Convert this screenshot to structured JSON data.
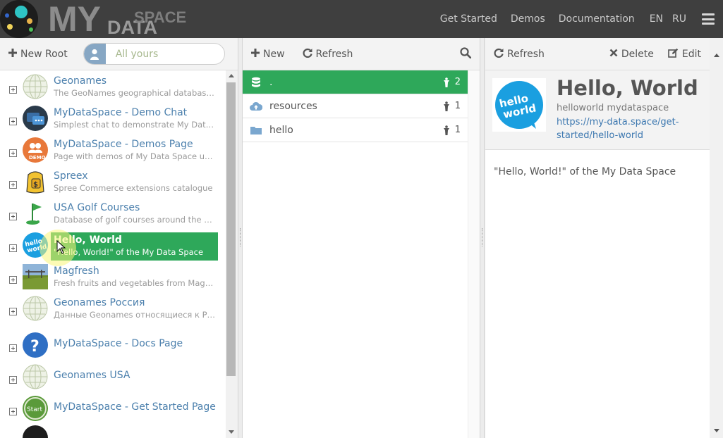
{
  "nav": {
    "logo_main": "MY",
    "logo_data": "DATA",
    "logo_space": "SPACE",
    "links": [
      "Get Started",
      "Demos",
      "Documentation"
    ],
    "langs": [
      "EN",
      "RU"
    ]
  },
  "left": {
    "new_root": "New Root",
    "search_placeholder": "All yours",
    "items": [
      {
        "title": "Geonames",
        "desc": "The GeoNames geographical database c...",
        "icon": "globe-icon"
      },
      {
        "title": "MyDataSpace - Demo Chat",
        "desc": "Simplest chat to demonstrate My Data ...",
        "icon": "chat-icon"
      },
      {
        "title": "MyDataSpace - Demos Page",
        "desc": "Page with demos of My Data Space usage",
        "icon": "demo-icon"
      },
      {
        "title": "Spreex",
        "desc": "Spree Commerce extensions catalogue",
        "icon": "backpack-icon"
      },
      {
        "title": "USA Golf Courses",
        "desc": "Database of golf courses around the W...",
        "icon": "golf-flag-icon"
      },
      {
        "title": "Hello, World",
        "desc": "\"Hello, World!\" of the My Data Space",
        "icon": "hello-world-icon"
      },
      {
        "title": "Magfresh",
        "desc": "Fresh fruits and vegetables from Magni...",
        "icon": "field-photo-icon"
      },
      {
        "title": "Geonames Россия",
        "desc": "Данные Geonames относящиеся к Рос...",
        "icon": "globe-icon"
      },
      {
        "title": "MyDataSpace - Docs Page",
        "desc": "",
        "icon": "question-icon"
      },
      {
        "title": "Geonames USA",
        "desc": "",
        "icon": "globe-icon"
      },
      {
        "title": "MyDataSpace - Get Started Page",
        "desc": "",
        "icon": "start-icon"
      }
    ]
  },
  "middle": {
    "new_label": "New",
    "refresh_label": "Refresh",
    "rows": [
      {
        "label": ".",
        "count": "2",
        "icon": "database-icon"
      },
      {
        "label": "resources",
        "count": "1",
        "icon": "cloud-upload-icon"
      },
      {
        "label": "hello",
        "count": "1",
        "icon": "folder-icon"
      }
    ]
  },
  "right": {
    "refresh_label": "Refresh",
    "delete_label": "Delete",
    "edit_label": "Edit",
    "logo_line1": "hello",
    "logo_line2": "world",
    "title": "Hello, World",
    "subtitle": "helloworld mydataspace",
    "url": "https://my-data.space/get-started/hello-world",
    "url_line1": "https://my-data.space/get-",
    "url_line2": "started/hello-world",
    "description": "\"Hello, World!\" of the My Data Space"
  },
  "colors": {
    "accent_green": "#2ea85a",
    "link_blue": "#4c80ad",
    "topbar": "#3f3f3f",
    "hello_world_blue": "#1a9fe0"
  }
}
